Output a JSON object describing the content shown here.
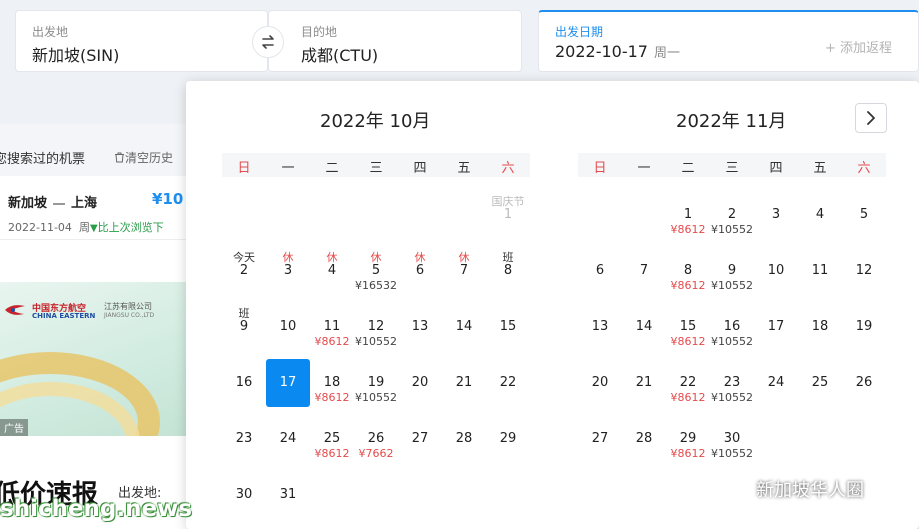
{
  "search": {
    "depart_label": "出发地",
    "depart_value": "新加坡(SIN)",
    "arrive_label": "目的地",
    "arrive_value": "成都(CTU)",
    "date_label": "出发日期",
    "date_value": "2022-10-17",
    "date_weekday": "周一",
    "return_label": "+ 添加返程"
  },
  "left": {
    "history_title": "您搜索过的机票",
    "clear_history": "清空历史",
    "history_item": {
      "from": "新加坡",
      "to": "上海",
      "price": "¥10",
      "date": "2022-11-04",
      "weekday_fragment": "周",
      "compare": "比上次浏览下"
    },
    "ad_brand_cn": "中国东方航空",
    "ad_brand_en": "CHINA EASTERN",
    "ad_sub_cn": "江苏有限公司",
    "ad_sub_en": "JIANGSU CO.,LTD",
    "ad_tag": "广告",
    "promo_title": "低价速报",
    "promo_from_label": "出发地:",
    "watermark": "shicheng.news"
  },
  "calendar": {
    "oct_title": "2022年 10月",
    "nov_title": "2022年 11月",
    "weekdays": [
      "日",
      "一",
      "二",
      "三",
      "四",
      "五",
      "六"
    ],
    "october": [
      {
        "top": "国庆节",
        "num": "1",
        "price": ""
      },
      {
        "top": "今天",
        "num": "2",
        "price": ""
      },
      {
        "top": "休",
        "num": "3",
        "price": ""
      },
      {
        "top": "休",
        "num": "4",
        "price": ""
      },
      {
        "top": "休",
        "num": "5",
        "price": "¥16532"
      },
      {
        "top": "休",
        "num": "6",
        "price": ""
      },
      {
        "top": "休",
        "num": "7",
        "price": ""
      },
      {
        "top": "班",
        "num": "8",
        "price": ""
      },
      {
        "top": "班",
        "num": "9",
        "price": ""
      },
      {
        "top": "",
        "num": "10",
        "price": ""
      },
      {
        "top": "",
        "num": "11",
        "price": "¥8612"
      },
      {
        "top": "",
        "num": "12",
        "price": "¥10552"
      },
      {
        "top": "",
        "num": "13",
        "price": ""
      },
      {
        "top": "",
        "num": "14",
        "price": ""
      },
      {
        "top": "",
        "num": "15",
        "price": ""
      },
      {
        "top": "",
        "num": "16",
        "price": ""
      },
      {
        "top": "",
        "num": "17",
        "price": ""
      },
      {
        "top": "",
        "num": "18",
        "price": "¥8612"
      },
      {
        "top": "",
        "num": "19",
        "price": "¥10552"
      },
      {
        "top": "",
        "num": "20",
        "price": ""
      },
      {
        "top": "",
        "num": "21",
        "price": ""
      },
      {
        "top": "",
        "num": "22",
        "price": ""
      },
      {
        "top": "",
        "num": "23",
        "price": ""
      },
      {
        "top": "",
        "num": "24",
        "price": ""
      },
      {
        "top": "",
        "num": "25",
        "price": "¥8612"
      },
      {
        "top": "",
        "num": "26",
        "price": "¥7662"
      },
      {
        "top": "",
        "num": "27",
        "price": ""
      },
      {
        "top": "",
        "num": "28",
        "price": ""
      },
      {
        "top": "",
        "num": "29",
        "price": ""
      },
      {
        "top": "",
        "num": "30",
        "price": ""
      },
      {
        "top": "",
        "num": "31",
        "price": ""
      }
    ],
    "november": [
      {
        "num": "1",
        "price": "¥8612"
      },
      {
        "num": "2",
        "price": "¥10552"
      },
      {
        "num": "3",
        "price": ""
      },
      {
        "num": "4",
        "price": ""
      },
      {
        "num": "5",
        "price": ""
      },
      {
        "num": "6",
        "price": ""
      },
      {
        "num": "7",
        "price": ""
      },
      {
        "num": "8",
        "price": "¥8612"
      },
      {
        "num": "9",
        "price": "¥10552"
      },
      {
        "num": "10",
        "price": ""
      },
      {
        "num": "11",
        "price": ""
      },
      {
        "num": "12",
        "price": ""
      },
      {
        "num": "13",
        "price": ""
      },
      {
        "num": "14",
        "price": ""
      },
      {
        "num": "15",
        "price": "¥8612"
      },
      {
        "num": "16",
        "price": "¥10552"
      },
      {
        "num": "17",
        "price": ""
      },
      {
        "num": "18",
        "price": ""
      },
      {
        "num": "19",
        "price": ""
      },
      {
        "num": "20",
        "price": ""
      },
      {
        "num": "21",
        "price": ""
      },
      {
        "num": "22",
        "price": "¥8612"
      },
      {
        "num": "23",
        "price": "¥10552"
      },
      {
        "num": "24",
        "price": ""
      },
      {
        "num": "25",
        "price": ""
      },
      {
        "num": "26",
        "price": ""
      },
      {
        "num": "27",
        "price": ""
      },
      {
        "num": "28",
        "price": ""
      },
      {
        "num": "29",
        "price": "¥8612"
      },
      {
        "num": "30",
        "price": "¥10552"
      }
    ]
  },
  "wechat_account": "新加坡华人圈",
  "colors": {
    "accent": "#0a8af1",
    "holiday_red": "#e54b4b",
    "price_blue": "#1f8ef1"
  }
}
